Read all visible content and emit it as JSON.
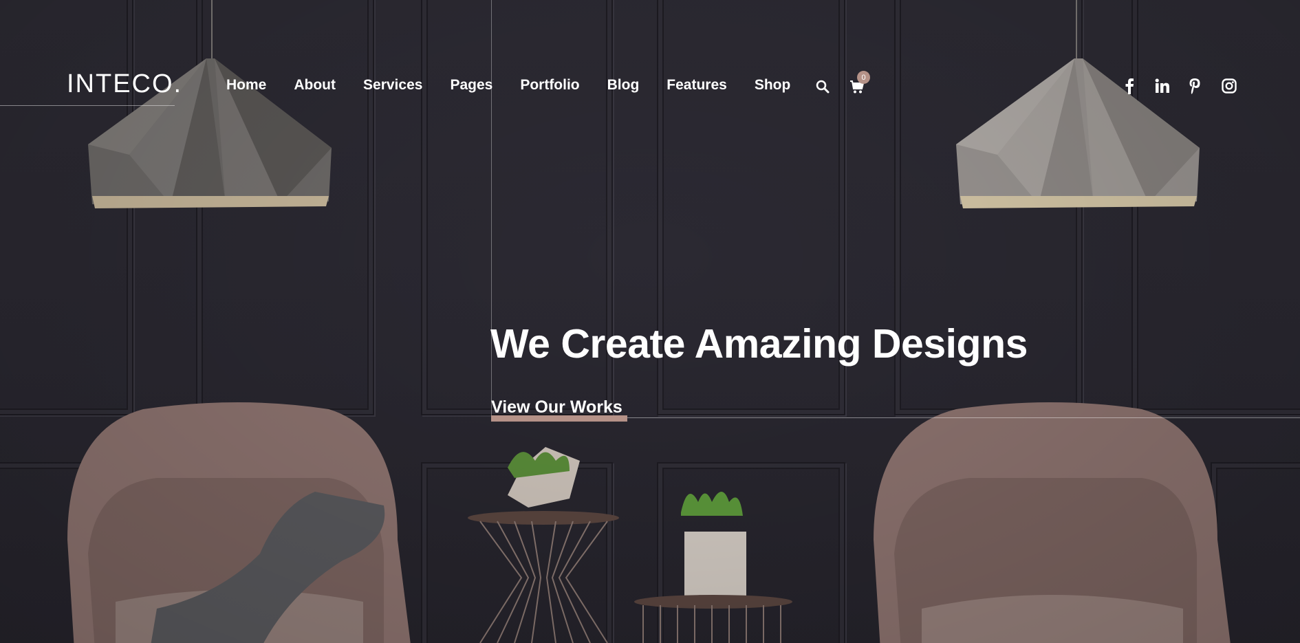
{
  "brand": {
    "logo_text": "INTECO."
  },
  "nav": {
    "items": [
      "Home",
      "About",
      "Services",
      "Pages",
      "Portfolio",
      "Blog",
      "Features",
      "Shop"
    ]
  },
  "header_icons": {
    "search": "search-icon",
    "cart": "cart-icon",
    "cart_count": "0"
  },
  "social": [
    "facebook-icon",
    "linkedin-icon",
    "pinterest-icon",
    "instagram-icon"
  ],
  "hero": {
    "title": "We Create Amazing Designs",
    "cta_label": "View Our Works"
  },
  "colors": {
    "accent": "#b59288",
    "background": "#2a2830",
    "text": "#ffffff"
  }
}
